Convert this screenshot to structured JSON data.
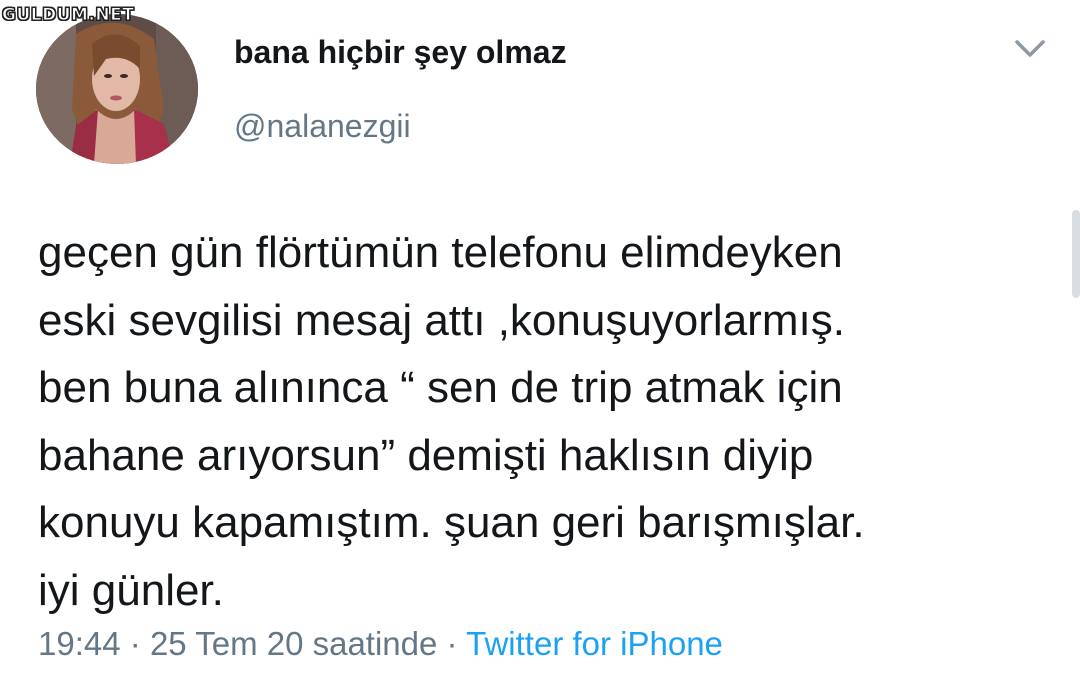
{
  "watermark": "GULDUM.NET",
  "tweet": {
    "display_name": "bana hiçbir şey olmaz",
    "handle": "@nalanezgii",
    "text_lines": [
      "geçen gün flörtümün telefonu elimdeyken",
      "eski sevgilisi mesaj attı ,konuşuyorlarmış.",
      "ben buna alınınca “ sen de trip atmak için",
      "bahane arıyorsun” demişti haklısın diyip",
      "konuyu kapamıştım. şuan geri barışmışlar.",
      "iyi günler."
    ],
    "time": "19:44",
    "separator": "·",
    "date": "25 Tem 20 saatinde",
    "source": "Twitter for iPhone"
  },
  "colors": {
    "text": "#14171a",
    "secondary": "#657786",
    "link": "#1da1f2"
  },
  "icons": {
    "menu": "chevron-down-icon"
  }
}
